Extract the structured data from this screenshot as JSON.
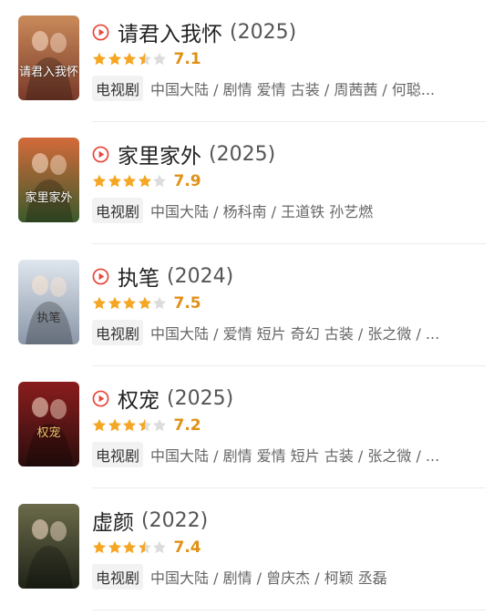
{
  "items": [
    {
      "title": "请君入我怀",
      "year": "(2025)",
      "has_play": true,
      "rating_stars": 3.5,
      "score": "7.1",
      "type_tag": "电视剧",
      "meta": "中国大陆 / 剧情 爱情 古装 / 周茜茜 / 何聪...",
      "poster_text": "请君入我怀",
      "poster_colors": [
        "#c98a5a",
        "#7a3a2a"
      ]
    },
    {
      "title": "家里家外",
      "year": "(2025)",
      "has_play": true,
      "rating_stars": 4,
      "score": "7.9",
      "type_tag": "电视剧",
      "meta": "中国大陆 / 杨科南 / 王道铁 孙艺燃",
      "poster_text": "家里家外",
      "poster_colors": [
        "#d46a3a",
        "#3b5a2c"
      ]
    },
    {
      "title": "执笔",
      "year": "(2024)",
      "has_play": true,
      "rating_stars": 4,
      "score": "7.5",
      "type_tag": "电视剧",
      "meta": "中国大陆 / 爱情 短片 奇幻 古装 / 张之微 / ...",
      "poster_text": "执笔",
      "poster_colors": [
        "#dfe6ee",
        "#8a97a8"
      ]
    },
    {
      "title": "权宠",
      "year": "(2025)",
      "has_play": true,
      "rating_stars": 3.5,
      "score": "7.2",
      "type_tag": "电视剧",
      "meta": "中国大陆 / 剧情 爱情 短片 古装 / 张之微 / ...",
      "poster_text": "权宠",
      "poster_colors": [
        "#8a1d1d",
        "#2b0d0d"
      ]
    },
    {
      "title": "虚颜",
      "year": "(2022)",
      "has_play": false,
      "rating_stars": 3.5,
      "score": "7.4",
      "type_tag": "电视剧",
      "meta": "中国大陆 / 剧情 / 曾庆杰 / 柯颖 丞磊",
      "poster_text": "",
      "poster_colors": [
        "#6b6a4a",
        "#1f2318"
      ]
    }
  ],
  "colors": {
    "star_full": "#f5a623",
    "star_empty": "#dcdcdc",
    "play": "#e8473b",
    "score": "#e09015"
  }
}
